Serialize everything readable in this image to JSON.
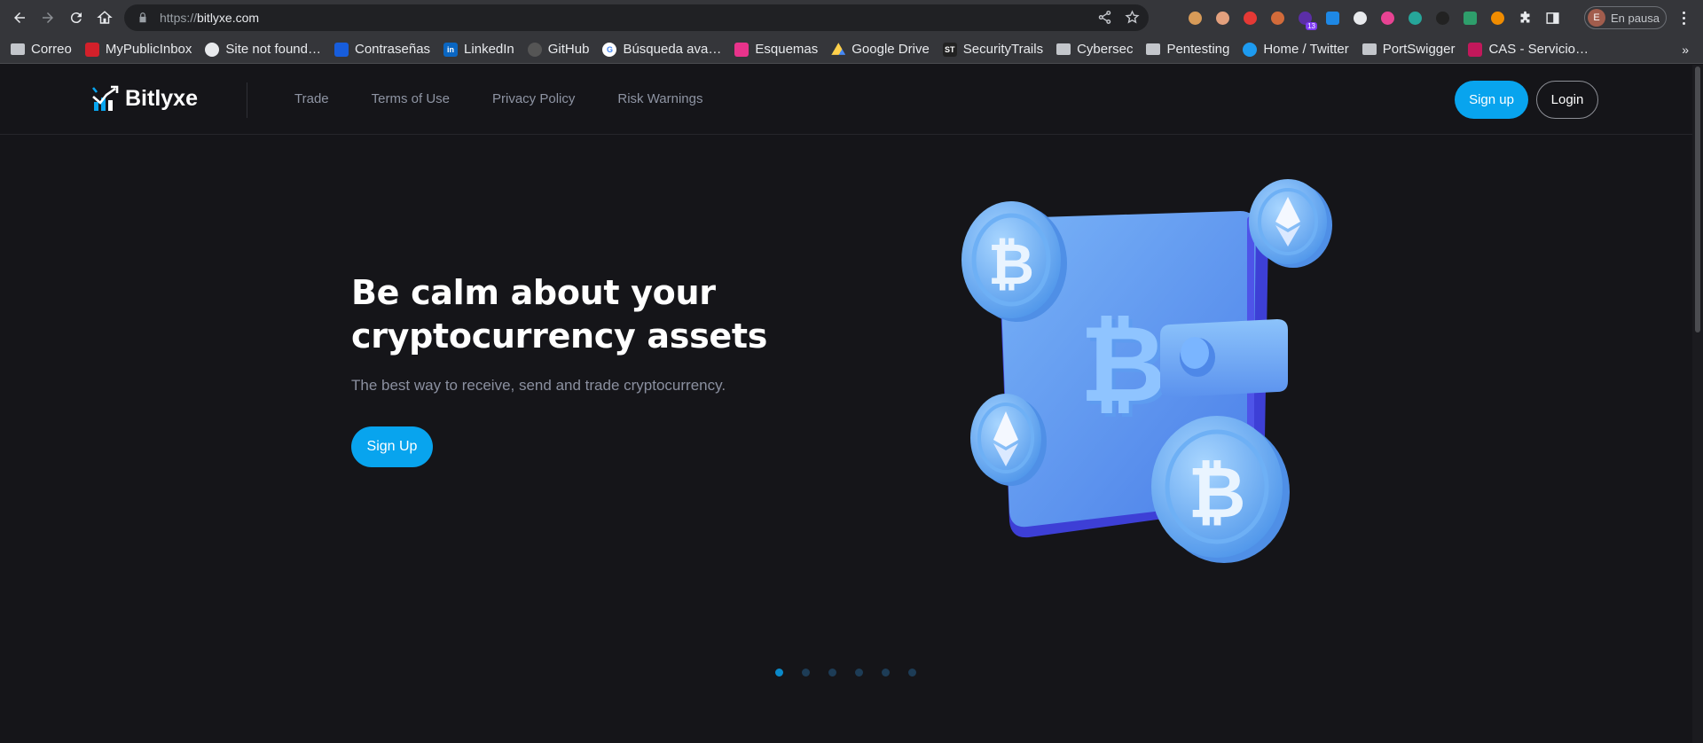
{
  "browser": {
    "url_scheme": "https://",
    "url_host": "bitlyxe.com",
    "profile_initial": "E",
    "profile_status": "En pausa",
    "extension_badge": "13",
    "bookmarks_more": "»",
    "bookmarks": [
      {
        "label": "Correo",
        "icon": "folder-icon"
      },
      {
        "label": "MyPublicInbox",
        "icon": "mypublicinbox-icon",
        "color": "#d3202a"
      },
      {
        "label": "Site not found…",
        "icon": "globe-icon",
        "color": "#e8eaed"
      },
      {
        "label": "Contraseñas",
        "icon": "bitwarden-icon",
        "color": "#175ddc"
      },
      {
        "label": "LinkedIn",
        "icon": "linkedin-icon",
        "color": "#0a66c2"
      },
      {
        "label": "GitHub",
        "icon": "github-icon",
        "color": "#555"
      },
      {
        "label": "Búsqueda ava…",
        "icon": "google-icon",
        "color": "#ffffff"
      },
      {
        "label": "Esquemas",
        "icon": "esquemas-icon",
        "color": "#e8338b"
      },
      {
        "label": "Google Drive",
        "icon": "google-drive-icon",
        "color": "#1fa463"
      },
      {
        "label": "SecurityTrails",
        "icon": "securitytrails-icon",
        "color": "#222"
      },
      {
        "label": "Cybersec",
        "icon": "folder-icon"
      },
      {
        "label": "Pentesting",
        "icon": "folder-icon"
      },
      {
        "label": "Home / Twitter",
        "icon": "twitter-icon",
        "color": "#1d9bf0"
      },
      {
        "label": "PortSwigger",
        "icon": "folder-icon"
      },
      {
        "label": "CAS - Servicio…",
        "icon": "cas-icon",
        "color": "#c2185b"
      }
    ]
  },
  "site": {
    "brand": "Bitlyxe",
    "nav": [
      "Trade",
      "Terms of Use",
      "Privacy Policy",
      "Risk Warnings"
    ],
    "signup_label": "Sign up",
    "login_label": "Login",
    "hero": {
      "title_line1": "Be calm about your",
      "title_line2": "cryptocurrency assets",
      "subtitle": "The best way to receive, send and trade cryptocurrency.",
      "cta": "Sign Up"
    },
    "carousel": {
      "slides": 6,
      "active": 1
    }
  },
  "colors": {
    "accent": "#08a4ee",
    "background": "#151519",
    "nav_text": "#8e94a3"
  }
}
